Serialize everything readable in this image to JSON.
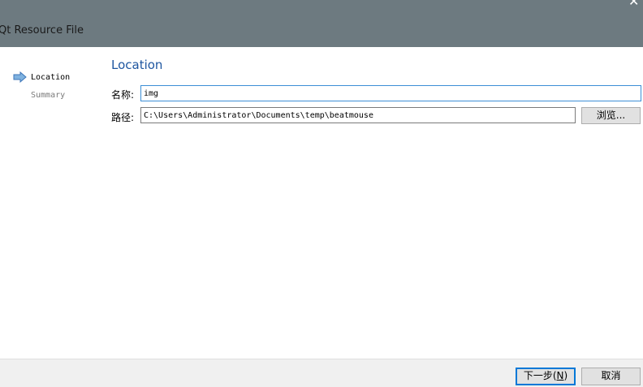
{
  "window": {
    "title": "Qt Resource File",
    "close_icon": "close-icon"
  },
  "steps": [
    {
      "label": "Location",
      "current": true,
      "icon": "arrow-right-icon"
    },
    {
      "label": "Summary",
      "current": false
    }
  ],
  "page": {
    "title": "Location",
    "name_label": "名称:",
    "name_value": "img",
    "path_label": "路径:",
    "path_value": "C:\\Users\\Administrator\\Documents\\temp\\beatmouse",
    "browse_label": "浏览..."
  },
  "footer": {
    "next_label_prefix": "下一步(",
    "next_accel": "N",
    "next_label_suffix": ")",
    "cancel_label": "取消"
  },
  "colors": {
    "titlebar": "#6d7a80",
    "accent": "#1e56a0",
    "focus_border": "#3c8fd6",
    "default_button_border": "#0078d7"
  }
}
